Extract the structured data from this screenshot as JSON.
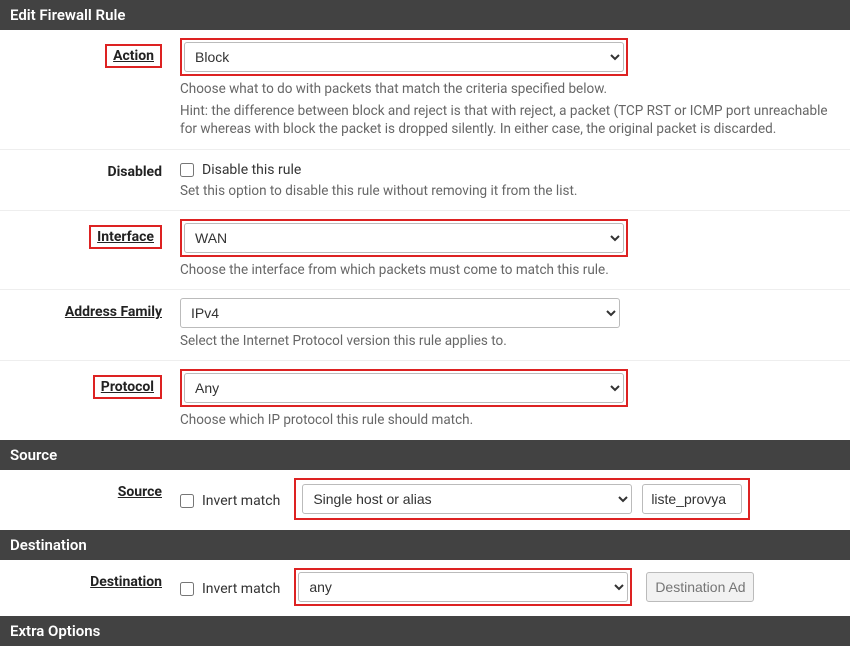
{
  "headers": {
    "edit": "Edit Firewall Rule",
    "source": "Source",
    "destination": "Destination",
    "extra": "Extra Options"
  },
  "action": {
    "label": "Action",
    "value": "Block",
    "help1": "Choose what to do with packets that match the criteria specified below.",
    "help2": "Hint: the difference between block and reject is that with reject, a packet (TCP RST or ICMP port unreachable for whereas with block the packet is dropped silently. In either case, the original packet is discarded."
  },
  "disabled": {
    "label": "Disabled",
    "checkbox_label": "Disable this rule",
    "help": "Set this option to disable this rule without removing it from the list."
  },
  "interface": {
    "label": "Interface",
    "value": "WAN",
    "help": "Choose the interface from which packets must come to match this rule."
  },
  "address_family": {
    "label": "Address Family",
    "value": "IPv4",
    "help": "Select the Internet Protocol version this rule applies to."
  },
  "protocol": {
    "label": "Protocol",
    "value": "Any",
    "help": "Choose which IP protocol this rule should match."
  },
  "source_row": {
    "label": "Source",
    "invert": "Invert match",
    "type": "Single host or alias",
    "alias": "liste_provya"
  },
  "destination_row": {
    "label": "Destination",
    "invert": "Invert match",
    "type": "any",
    "placeholder": "Destination Addr"
  }
}
